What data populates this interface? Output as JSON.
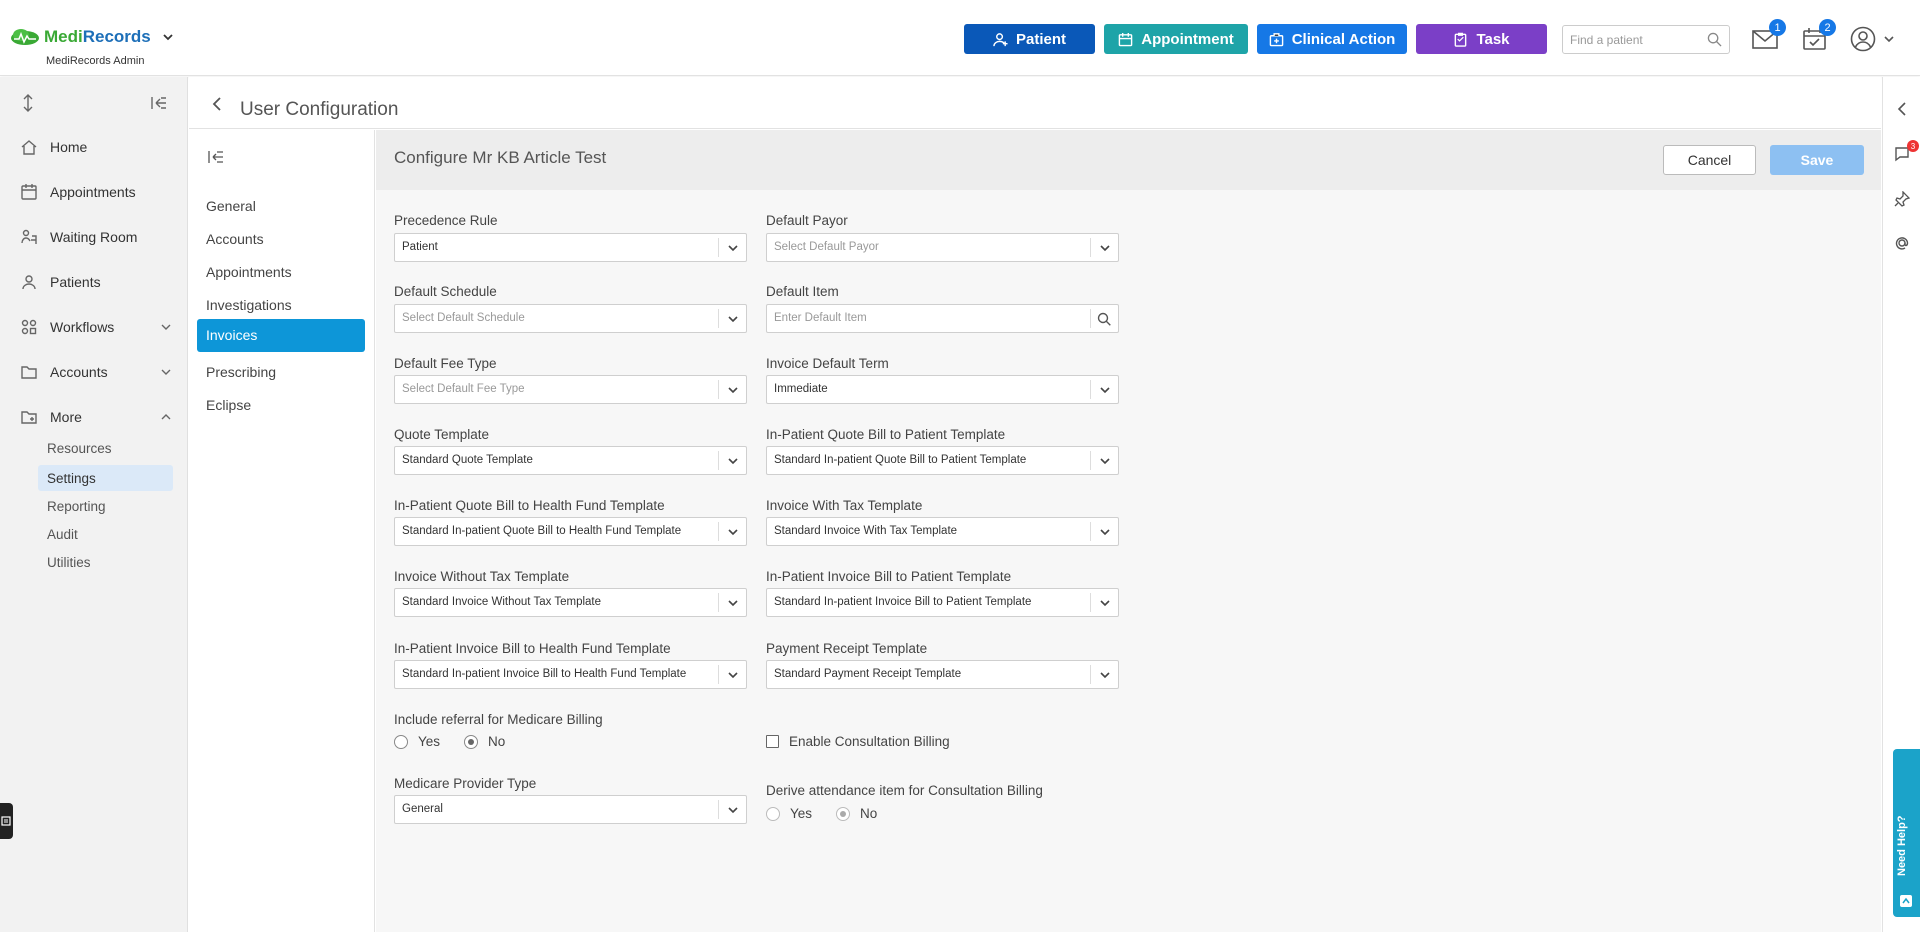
{
  "app": {
    "logo_part1": "Medi",
    "logo_part2": "Records",
    "subtitle": "MediRecords Admin"
  },
  "topbar": {
    "patient_btn": "Patient",
    "appointment_btn": "Appointment",
    "clinical_btn": "Clinical Action",
    "task_btn": "Task",
    "search_placeholder": "Find a patient",
    "mail_count": "1",
    "task_count": "2",
    "colors": {
      "patient": "#0a58b8",
      "appointment": "#1ea4a8",
      "clinical": "#1678e6",
      "task": "#7b3fc7"
    }
  },
  "sidebar": {
    "items": [
      {
        "label": "Home",
        "icon": "home-icon"
      },
      {
        "label": "Appointments",
        "icon": "calendar-icon"
      },
      {
        "label": "Waiting Room",
        "icon": "waiting-room-icon"
      },
      {
        "label": "Patients",
        "icon": "patients-icon"
      },
      {
        "label": "Workflows",
        "icon": "workflows-icon"
      },
      {
        "label": "Accounts",
        "icon": "folder-icon"
      },
      {
        "label": "More",
        "icon": "more-folder-icon"
      }
    ],
    "sub_items": [
      "Resources",
      "Settings",
      "Reporting",
      "Audit",
      "Utilities"
    ]
  },
  "header": {
    "title": "User Configuration"
  },
  "config_nav": {
    "items": [
      "General",
      "Accounts",
      "Appointments",
      "Investigations",
      "Invoices",
      "Prescribing",
      "Eclipse"
    ],
    "active": "Invoices"
  },
  "main": {
    "title": "Configure Mr KB Article Test",
    "cancel": "Cancel",
    "save": "Save",
    "fields": {
      "precedence_rule": {
        "label": "Precedence Rule",
        "value": "Patient"
      },
      "default_payor": {
        "label": "Default Payor",
        "placeholder": "Select Default Payor"
      },
      "default_schedule": {
        "label": "Default Schedule",
        "placeholder": "Select Default Schedule"
      },
      "default_item": {
        "label": "Default Item",
        "placeholder": "Enter Default Item"
      },
      "default_fee_type": {
        "label": "Default Fee Type",
        "placeholder": "Select Default Fee Type"
      },
      "invoice_default_term": {
        "label": "Invoice Default Term",
        "value": "Immediate"
      },
      "quote_template": {
        "label": "Quote Template",
        "value": "Standard Quote Template"
      },
      "inpatient_quote_patient": {
        "label": "In-Patient Quote Bill to Patient Template",
        "value": "Standard In-patient Quote Bill to Patient Template"
      },
      "inpatient_quote_fund": {
        "label": "In-Patient Quote Bill to Health Fund Template",
        "value": "Standard In-patient Quote Bill to Health Fund Template"
      },
      "invoice_with_tax": {
        "label": "Invoice With Tax Template",
        "value": "Standard Invoice With Tax Template"
      },
      "invoice_without_tax": {
        "label": "Invoice Without Tax Template",
        "value": "Standard Invoice Without Tax Template"
      },
      "inpatient_invoice_patient": {
        "label": "In-Patient Invoice Bill to Patient Template",
        "value": "Standard In-patient Invoice Bill to Patient Template"
      },
      "inpatient_invoice_fund": {
        "label": "In-Patient Invoice Bill to Health Fund Template",
        "value": "Standard In-patient Invoice Bill to Health Fund Template"
      },
      "payment_receipt": {
        "label": "Payment Receipt Template",
        "value": "Standard Payment Receipt Template"
      },
      "include_referral": {
        "label": "Include referral for Medicare Billing",
        "yes": "Yes",
        "no": "No",
        "selected": "No"
      },
      "enable_consultation": {
        "label": "Enable Consultation Billing",
        "checked": false
      },
      "medicare_provider_type": {
        "label": "Medicare Provider Type",
        "value": "General"
      },
      "derive_attendance": {
        "label": "Derive attendance item for Consultation Billing",
        "yes": "Yes",
        "no": "No",
        "selected": "No"
      }
    }
  },
  "right_rail": {
    "notification_count": "3",
    "need_help": "Need Help?"
  }
}
